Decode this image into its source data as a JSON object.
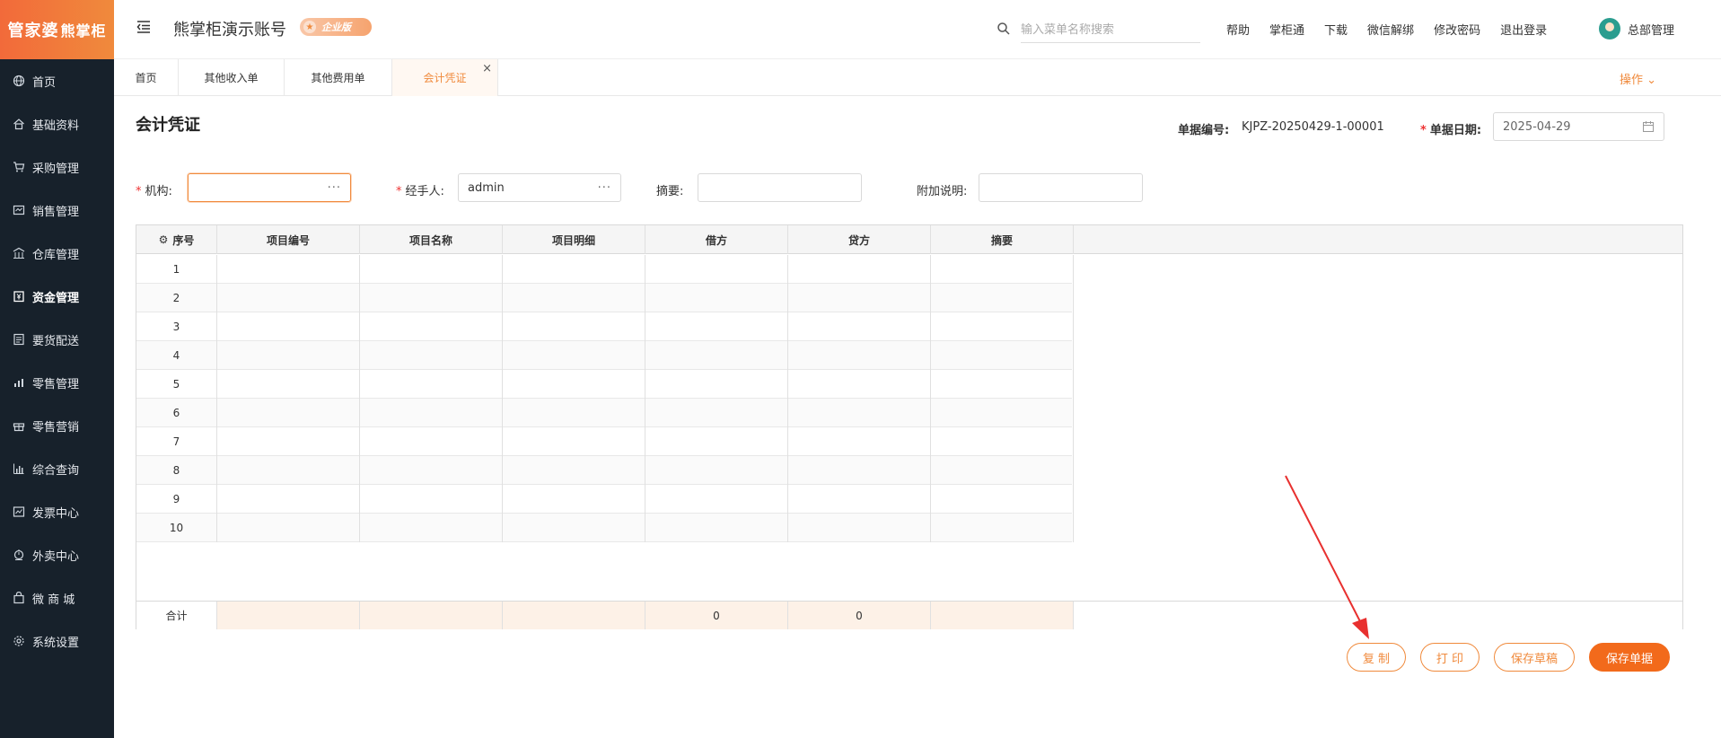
{
  "logo": {
    "main": "管家婆",
    "sub": "熊掌柜"
  },
  "sidebar": {
    "items": [
      {
        "label": "首页",
        "icon": "globe-icon"
      },
      {
        "label": "基础资料",
        "icon": "home-icon"
      },
      {
        "label": "采购管理",
        "icon": "cart-icon"
      },
      {
        "label": "销售管理",
        "icon": "sales-icon"
      },
      {
        "label": "仓库管理",
        "icon": "warehouse-icon"
      },
      {
        "label": "资金管理",
        "icon": "money-icon"
      },
      {
        "label": "要货配送",
        "icon": "list-icon"
      },
      {
        "label": "零售管理",
        "icon": "chart-icon"
      },
      {
        "label": "零售营销",
        "icon": "gift-icon"
      },
      {
        "label": "综合查询",
        "icon": "bar-chart-icon"
      },
      {
        "label": "发票中心",
        "icon": "invoice-icon"
      },
      {
        "label": "外卖中心",
        "icon": "delivery-icon"
      },
      {
        "label": "微 商 城",
        "icon": "shop-icon"
      },
      {
        "label": "系统设置",
        "icon": "gear-icon"
      }
    ],
    "active_index": 5
  },
  "header": {
    "account_title": "熊掌柜演示账号",
    "badge": "企业版",
    "search_placeholder": "输入菜单名称搜索",
    "links": [
      "帮助",
      "掌柜通",
      "下载",
      "微信解绑",
      "修改密码",
      "退出登录"
    ],
    "user_name": "总部管理"
  },
  "tabs": {
    "items": [
      "首页",
      "其他收入单",
      "其他费用单",
      "会计凭证"
    ],
    "active_index": 3,
    "operations": "操作"
  },
  "form": {
    "title": "会计凭证",
    "doc_no_label": "单据编号:",
    "doc_no": "KJPZ-20250429-1-00001",
    "date_label": "单据日期:",
    "date": "2025-04-29",
    "org_label": "机构:",
    "org_value": "",
    "handler_label": "经手人:",
    "handler_value": "admin",
    "summary_label": "摘要:",
    "summary_value": "",
    "note_label": "附加说明:",
    "note_value": ""
  },
  "grid": {
    "columns": [
      "序号",
      "项目编号",
      "项目名称",
      "项目明细",
      "借方",
      "贷方",
      "摘要"
    ],
    "rows": [
      "1",
      "2",
      "3",
      "4",
      "5",
      "6",
      "7",
      "8",
      "9",
      "10"
    ],
    "total_label": "合计",
    "total_debit": "0",
    "total_credit": "0"
  },
  "buttons": {
    "copy": "复 制",
    "print": "打 印",
    "save_draft": "保存草稿",
    "save": "保存单据"
  },
  "colors": {
    "accent": "#f08a3c",
    "primary": "#f26a1b",
    "sidebar": "#17212b",
    "annotation": "#e8302f"
  }
}
